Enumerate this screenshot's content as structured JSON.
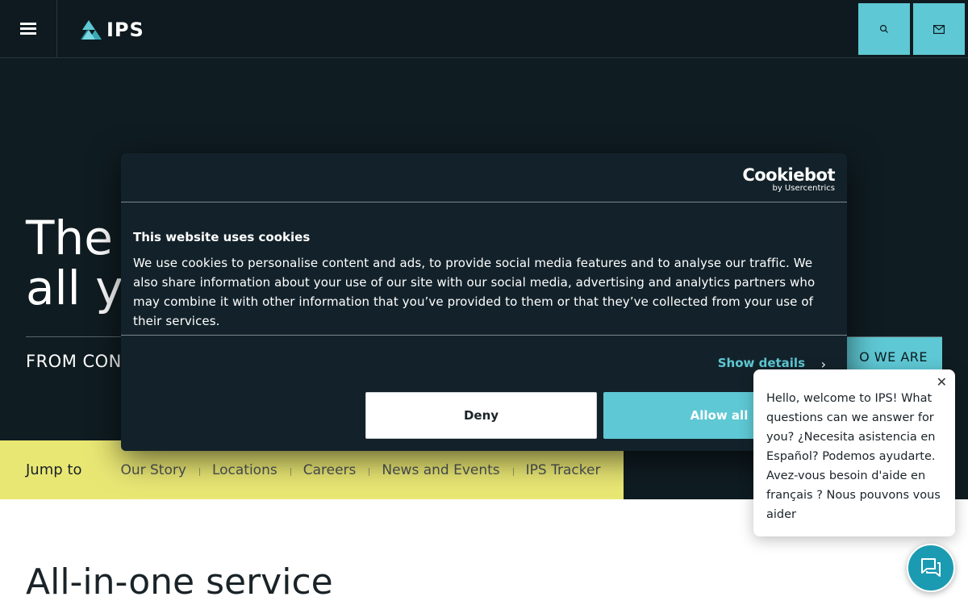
{
  "header": {
    "logo_text": "IPS",
    "menu_icon": "hamburger-icon",
    "search_icon": "search-icon",
    "mail_icon": "mail-icon"
  },
  "hero": {
    "title_visible": "The\nall y",
    "subtitle_visible": "FROM CON",
    "cta_visible": "O WE ARE"
  },
  "jumpbar": {
    "label": "Jump to",
    "links": [
      "Our Story",
      "Locations",
      "Careers",
      "News and Events",
      "IPS Tracker"
    ]
  },
  "section": {
    "title": "All-in-one service"
  },
  "cookie_dialog": {
    "brand": "Cookiebot",
    "brand_sub": "by Usercentrics",
    "title": "This website uses cookies",
    "text": "We use cookies to personalise content and ads, to provide social media features and to analyse our traffic. We also share information about your use of our site with our social media, advertising and analytics partners who may combine it with other information that you’ve provided to them or that they’ve collected from your use of their services.",
    "show_details": "Show details",
    "deny": "Deny",
    "allow_all": "Allow all"
  },
  "chat": {
    "message": "Hello, welcome to IPS! What questions can we answer for you? ¿Necesita asistencia en Español? Podemos ayudarte. Avez-vous besoin d'aide en français ? Nous pouvons vous aider",
    "close_icon": "close-icon",
    "launcher_icon": "chat-icon"
  },
  "colors": {
    "accent": "#5ec8d4",
    "dark_bg": "#0f1c21",
    "jumpbar_bg": "#e9e774",
    "dialog_bg": "#13222a"
  }
}
